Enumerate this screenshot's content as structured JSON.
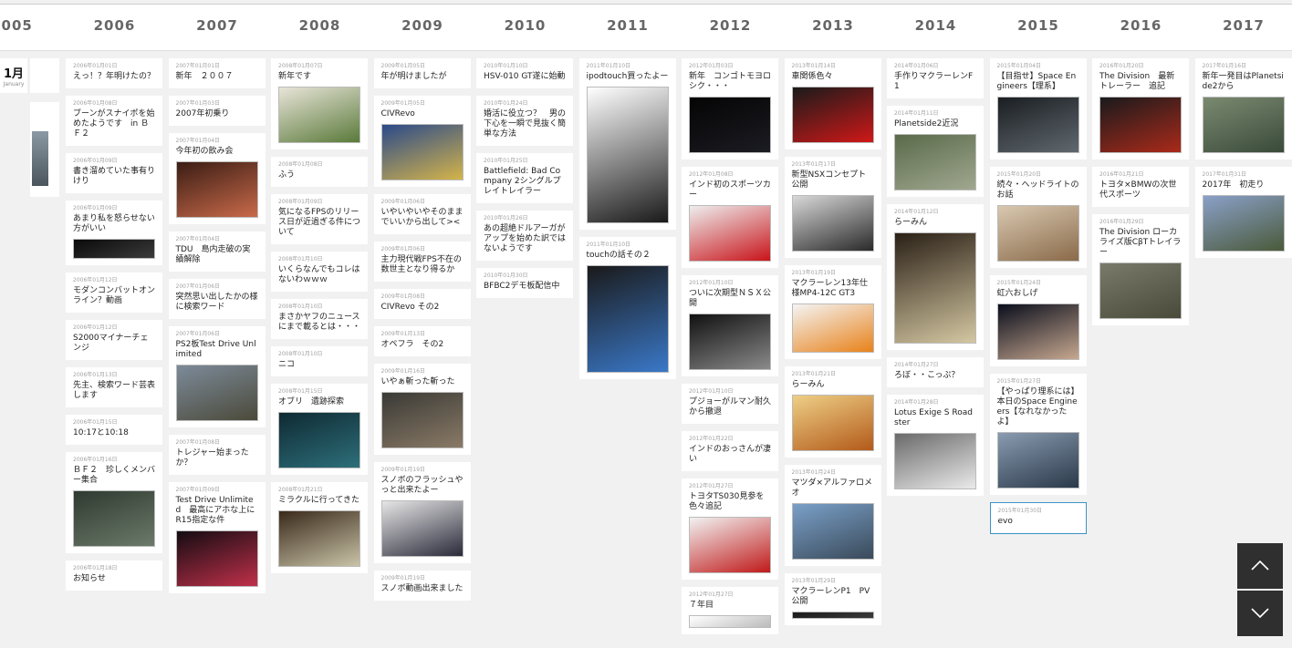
{
  "years": [
    "2005",
    "2006",
    "2007",
    "2008",
    "2009",
    "2010",
    "2011",
    "2012",
    "2013",
    "2014",
    "2015",
    "2016",
    "2017"
  ],
  "month_label": {
    "jp": "1月",
    "en": "January"
  },
  "columns": [
    {
      "year": "2006",
      "posts": [
        {
          "date": "2006年01月01日",
          "title": "えっ！？年明けたの？"
        },
        {
          "date": "2006年01月08日",
          "title": "ブーンがスナイポを始めたようです　in ＢＦ２"
        },
        {
          "date": "2006年01月09日",
          "title": "書き溜めていた事有りけり"
        },
        {
          "date": "2006年01月09日",
          "title": "あまり私を怒らせない方がいい",
          "thumb": "thumb-dark-banner"
        },
        {
          "date": "2006年01月12日",
          "title": "モダンコンバットオンライン？動画"
        },
        {
          "date": "2006年01月12日",
          "title": "S2000マイナーチェンジ"
        },
        {
          "date": "2006年01月13日",
          "title": "先主、検索ワード芸表します"
        },
        {
          "date": "2006年01月15日",
          "title": "10:17と10:18"
        },
        {
          "date": "2006年01月16日",
          "title": "ＢＦ２　珍しくメンバー集合",
          "thumb": "thumb-game-screenshot"
        },
        {
          "date": "2006年01月18日",
          "title": "お知らせ"
        }
      ]
    },
    {
      "year": "2007",
      "posts": [
        {
          "date": "2007年01月01日",
          "title": "新年　２００７"
        },
        {
          "date": "2007年01月03日",
          "title": "2007年初乗り"
        },
        {
          "date": "2007年01月04日",
          "title": "今年初の飲み会",
          "thumb": "thumb-food-sushi"
        },
        {
          "date": "2007年01月04日",
          "title": "TDU　島内走破の実績解除"
        },
        {
          "date": "2007年01月06日",
          "title": "突然思い出したかの様に検索ワード"
        },
        {
          "date": "2007年01月06日",
          "title": "PS2板Test Drive Unlimited",
          "thumb": "thumb-racing-game"
        },
        {
          "date": "2007年01月08日",
          "title": "トレジャー始まったか？"
        },
        {
          "date": "2007年01月09日",
          "title": "Test Drive Unlimited　最高にアホな上にR15指定な件",
          "thumb": "thumb-game-scenes"
        }
      ]
    },
    {
      "year": "2008",
      "posts": [
        {
          "date": "2008年01月07日",
          "title": "新年です",
          "thumb": "thumb-ramen-bowl"
        },
        {
          "date": "2008年01月08日",
          "title": "ふう"
        },
        {
          "date": "2008年01月09日",
          "title": "気になるFPSのリリース日が近過ぎる件について"
        },
        {
          "date": "2008年01月10日",
          "title": "いくらなんでもコレはないわｗｗｗ"
        },
        {
          "date": "2008年01月10日",
          "title": "まさかヤフのニュースにまで載るとは・・・"
        },
        {
          "date": "2008年01月10日",
          "title": "ニコ"
        },
        {
          "date": "2008年01月15日",
          "title": "オブリ　遺跡探索",
          "thumb": "thumb-dungeon"
        },
        {
          "date": "2008年01月21日",
          "title": "ミラクルに行ってきた",
          "thumb": "thumb-noodle-bowl"
        }
      ]
    },
    {
      "year": "2009",
      "posts": [
        {
          "date": "2009年01月05日",
          "title": "年が明けましたが"
        },
        {
          "date": "2009年01月05日",
          "title": "CIVRevo",
          "thumb": "thumb-strategy-map"
        },
        {
          "date": "2009年01月06日",
          "title": "いやいやいやそのままでいいから出して><"
        },
        {
          "date": "2009年01月06日",
          "title": "主力現代戦FPS不在の数世主となり得るか"
        },
        {
          "date": "2009年01月08日",
          "title": "CIVRevo その2"
        },
        {
          "date": "2009年01月13日",
          "title": "オペフラ　その2"
        },
        {
          "date": "2009年01月16日",
          "title": "いやぁ斬った斬った",
          "thumb": "thumb-firewood"
        },
        {
          "date": "2009年01月19日",
          "title": "スノボのフラッシュやっと出来たよー",
          "thumb": "thumb-news-photo"
        },
        {
          "date": "2009年01月19日",
          "title": "スノボ動画出来ました"
        }
      ]
    },
    {
      "year": "2010",
      "posts": [
        {
          "date": "2010年01月10日",
          "title": "HSV-010 GT遂に始動"
        },
        {
          "date": "2010年01月24日",
          "title": "婚活に役立つ？　男の下心を一瞬で見抜く簡単な方法"
        },
        {
          "date": "2010年01月25日",
          "title": "Battlefield: Bad Company 2シングルプレイトレイラー"
        },
        {
          "date": "2010年01月26日",
          "title": "あの超絶ドルアーガがアップを始めた訳ではないようです"
        },
        {
          "date": "2010年01月30日",
          "title": "BFBC2デモ板配信中"
        }
      ]
    },
    {
      "year": "2011",
      "posts": [
        {
          "date": "2011年01月10日",
          "title": "ipodtouch買ったよー",
          "thumb": "thumb-ipod-touch"
        },
        {
          "date": "2011年01月10日",
          "title": "touchの話その２",
          "thumb": "thumb-ipod-homescreen"
        }
      ]
    },
    {
      "year": "2012",
      "posts": [
        {
          "date": "2012年01月03日",
          "title": "新年　コンゴトモヨロシク・・・",
          "thumb": "thumb-night-city"
        },
        {
          "date": "2012年01月08日",
          "title": "インド初のスポーツカー",
          "thumb": "thumb-red-sportscar"
        },
        {
          "date": "2012年01月10日",
          "title": "ついに次期型ＮＳＸ公開",
          "thumb": "thumb-silver-car"
        },
        {
          "date": "2012年01月10日",
          "title": "プジョーがルマン耐久から撤退"
        },
        {
          "date": "2012年01月22日",
          "title": "インドのおっさんが凄い"
        },
        {
          "date": "2012年01月27日",
          "title": "トヨタTS030見参を色々追記",
          "thumb": "thumb-race-car"
        },
        {
          "date": "2012年01月27日",
          "title": "７年目",
          "thumb": "thumb-text-page"
        }
      ]
    },
    {
      "year": "2013",
      "posts": [
        {
          "date": "2013年01月14日",
          "title": "車関係色々",
          "thumb": "thumb-ferrari"
        },
        {
          "date": "2013年01月17日",
          "title": "新型NSXコンセプト公開",
          "thumb": "thumb-nsx-concept"
        },
        {
          "date": "2013年01月19日",
          "title": "マクラーレン13年仕様MP4-12C GT3",
          "thumb": "thumb-mclaren-orange"
        },
        {
          "date": "2013年01月21日",
          "title": "らーみん",
          "thumb": "thumb-ramen-yellow"
        },
        {
          "date": "2013年01月24日",
          "title": "マツダ×アルファロメオ",
          "thumb": "thumb-roadster"
        },
        {
          "date": "2013年01月29日",
          "title": "マクラーレンP1　PV公開",
          "thumb": "thumb-dark-car"
        }
      ]
    },
    {
      "year": "2014",
      "posts": [
        {
          "date": "2014年01月06日",
          "title": "手作りマクラーレンF1"
        },
        {
          "date": "2014年01月11日",
          "title": "Planetside2近況",
          "thumb": "thumb-planetside"
        },
        {
          "date": "2014年01月12日",
          "title": "らーみん",
          "thumb": "thumb-ramen-tall"
        },
        {
          "date": "2014年01月27日",
          "title": "ろぼ・・こっぷ？"
        },
        {
          "date": "2014年01月28日",
          "title": "Lotus Exige S Roadster",
          "thumb": "thumb-lotus"
        }
      ]
    },
    {
      "year": "2015",
      "posts": [
        {
          "date": "2015年01月04日",
          "title": "【目指せ】Space Engineers【理系】",
          "thumb": "thumb-space-engineers"
        },
        {
          "date": "2015年01月20日",
          "title": "続々・ヘッドライトのお話",
          "thumb": "thumb-headlight-diy"
        },
        {
          "date": "2015年01月24日",
          "title": "虹六おしげ",
          "thumb": "thumb-presenter"
        },
        {
          "date": "2015年01月27日",
          "title": "【やっぱり理系には】本日のSpace Engineers【なれなかったよ】",
          "thumb": "thumb-space-ship"
        },
        {
          "date": "2015年01月30日",
          "title": "evo",
          "selected": true
        }
      ]
    },
    {
      "year": "2016",
      "posts": [
        {
          "date": "2016年01月20日",
          "title": "The Division　最新トレーラー　追記",
          "thumb": "thumb-division-trailer"
        },
        {
          "date": "2016年01月21日",
          "title": "トヨタ×BMWの次世代スポーツ"
        },
        {
          "date": "2016年01月29日",
          "title": "The Division ローカライズ版CβTトレイラー",
          "thumb": "thumb-division-street"
        }
      ]
    },
    {
      "year": "2017",
      "posts": [
        {
          "date": "2017年01月16日",
          "title": "新年一発目はPlanetside2から",
          "thumb": "thumb-planetside-battle"
        },
        {
          "date": "2017年01月31日",
          "title": "2017年　初走り",
          "thumb": "thumb-mountain-car"
        }
      ]
    }
  ],
  "thumb_colors": {
    "thumb-dark-banner": [
      "#0a0a0a",
      "#3b3b3b"
    ],
    "thumb-game-screenshot": [
      "#2f3a30",
      "#6b7a6a"
    ],
    "thumb-food-sushi": [
      "#3b1d14",
      "#c96a4a"
    ],
    "thumb-racing-game": [
      "#7c8a99",
      "#4b4a3a"
    ],
    "thumb-game-scenes": [
      "#140c12",
      "#c0304a"
    ],
    "thumb-ramen-bowl": [
      "#e8e4d8",
      "#5a7a3a"
    ],
    "thumb-dungeon": [
      "#0f2a33",
      "#2d6f7a"
    ],
    "thumb-noodle-bowl": [
      "#3a2a1a",
      "#c9c3a8"
    ],
    "thumb-strategy-map": [
      "#2b4a8a",
      "#d4b44a"
    ],
    "thumb-firewood": [
      "#3a3a36",
      "#8a7a66"
    ],
    "thumb-news-photo": [
      "#e6e6e6",
      "#2a2a3a"
    ],
    "thumb-ipod-touch": [
      "#ffffff",
      "#1a1a1a"
    ],
    "thumb-ipod-homescreen": [
      "#1a1a1a",
      "#3a78c8"
    ],
    "thumb-night-city": [
      "#050505",
      "#1b1b22"
    ],
    "thumb-red-sportscar": [
      "#eeeeee",
      "#c8141a"
    ],
    "thumb-silver-car": [
      "#111111",
      "#8a8a8a"
    ],
    "thumb-race-car": [
      "#f2f2f2",
      "#c01a1a"
    ],
    "thumb-text-page": [
      "#ffffff",
      "#bbbbbb"
    ],
    "thumb-ferrari": [
      "#1a1a1a",
      "#d01818"
    ],
    "thumb-nsx-concept": [
      "#d8d8d8",
      "#2a2a2a"
    ],
    "thumb-mclaren-orange": [
      "#f4f4f4",
      "#e8821a"
    ],
    "thumb-ramen-yellow": [
      "#eecf86",
      "#b35a1a"
    ],
    "thumb-roadster": [
      "#7aa0c8",
      "#3a4a5a"
    ],
    "thumb-dark-car": [
      "#1a1a1a",
      "#3a3a3a"
    ],
    "thumb-planetside": [
      "#5a6a4a",
      "#a0a890"
    ],
    "thumb-ramen-tall": [
      "#2a2016",
      "#d4c7a2"
    ],
    "thumb-lotus": [
      "#6a6a6a",
      "#eaeaea"
    ],
    "thumb-space-engineers": [
      "#1a1e22",
      "#60686e"
    ],
    "thumb-headlight-diy": [
      "#d8c8b0",
      "#8a6a4a"
    ],
    "thumb-presenter": [
      "#0a0e1c",
      "#c7a890"
    ],
    "thumb-space-ship": [
      "#8a9ab0",
      "#2a3a4a"
    ],
    "thumb-division-trailer": [
      "#1a1a1c",
      "#aa2a1a"
    ],
    "thumb-division-street": [
      "#7a7a6a",
      "#4a4a3a"
    ],
    "thumb-planetside-battle": [
      "#7a8a70",
      "#3a4a3a"
    ],
    "thumb-mountain-car": [
      "#8aa0c8",
      "#4a5a3a"
    ]
  },
  "nav": {
    "up": "scroll-up",
    "down": "scroll-down"
  }
}
